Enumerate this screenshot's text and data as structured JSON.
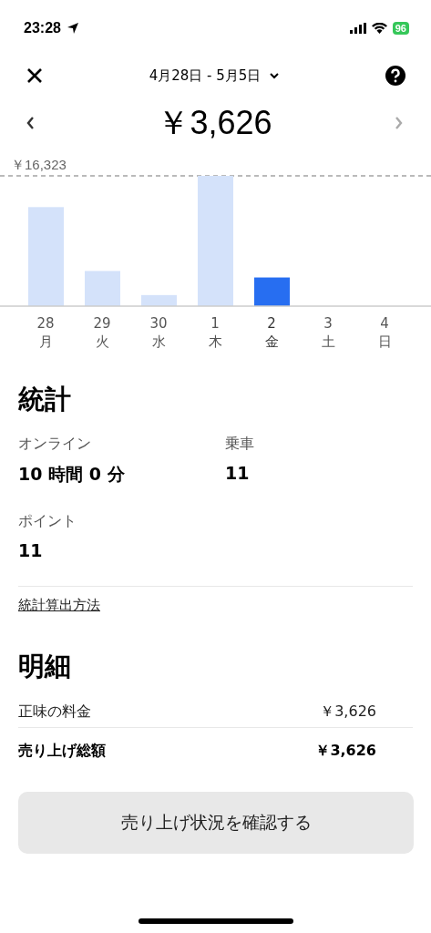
{
  "status_bar": {
    "time": "23:28",
    "battery": "96"
  },
  "header": {
    "date_range": "4月28日 - 5月5日"
  },
  "total": "￥3,626",
  "chart": {
    "max_label": "￥16,323",
    "days": [
      {
        "day": "28",
        "weekday": "月",
        "selected": false
      },
      {
        "day": "29",
        "weekday": "火",
        "selected": false
      },
      {
        "day": "30",
        "weekday": "水",
        "selected": false
      },
      {
        "day": "1",
        "weekday": "木",
        "selected": false
      },
      {
        "day": "2",
        "weekday": "金",
        "selected": true
      },
      {
        "day": "3",
        "weekday": "土",
        "selected": false
      },
      {
        "day": "4",
        "weekday": "日",
        "selected": false
      }
    ]
  },
  "stats": {
    "title": "統計",
    "items": [
      {
        "label": "オンライン",
        "value": "10 時間 0 分"
      },
      {
        "label": "乗車",
        "value": "11"
      },
      {
        "label": "ポイント",
        "value": "11"
      }
    ],
    "link": "統計算出方法"
  },
  "details": {
    "title": "明細",
    "rows": [
      {
        "label": "正味の料金",
        "value": "￥3,626",
        "bold": false
      },
      {
        "label": "売り上げ総額",
        "value": "￥3,626",
        "bold": true
      }
    ]
  },
  "button": "売り上げ状況を確認する"
}
